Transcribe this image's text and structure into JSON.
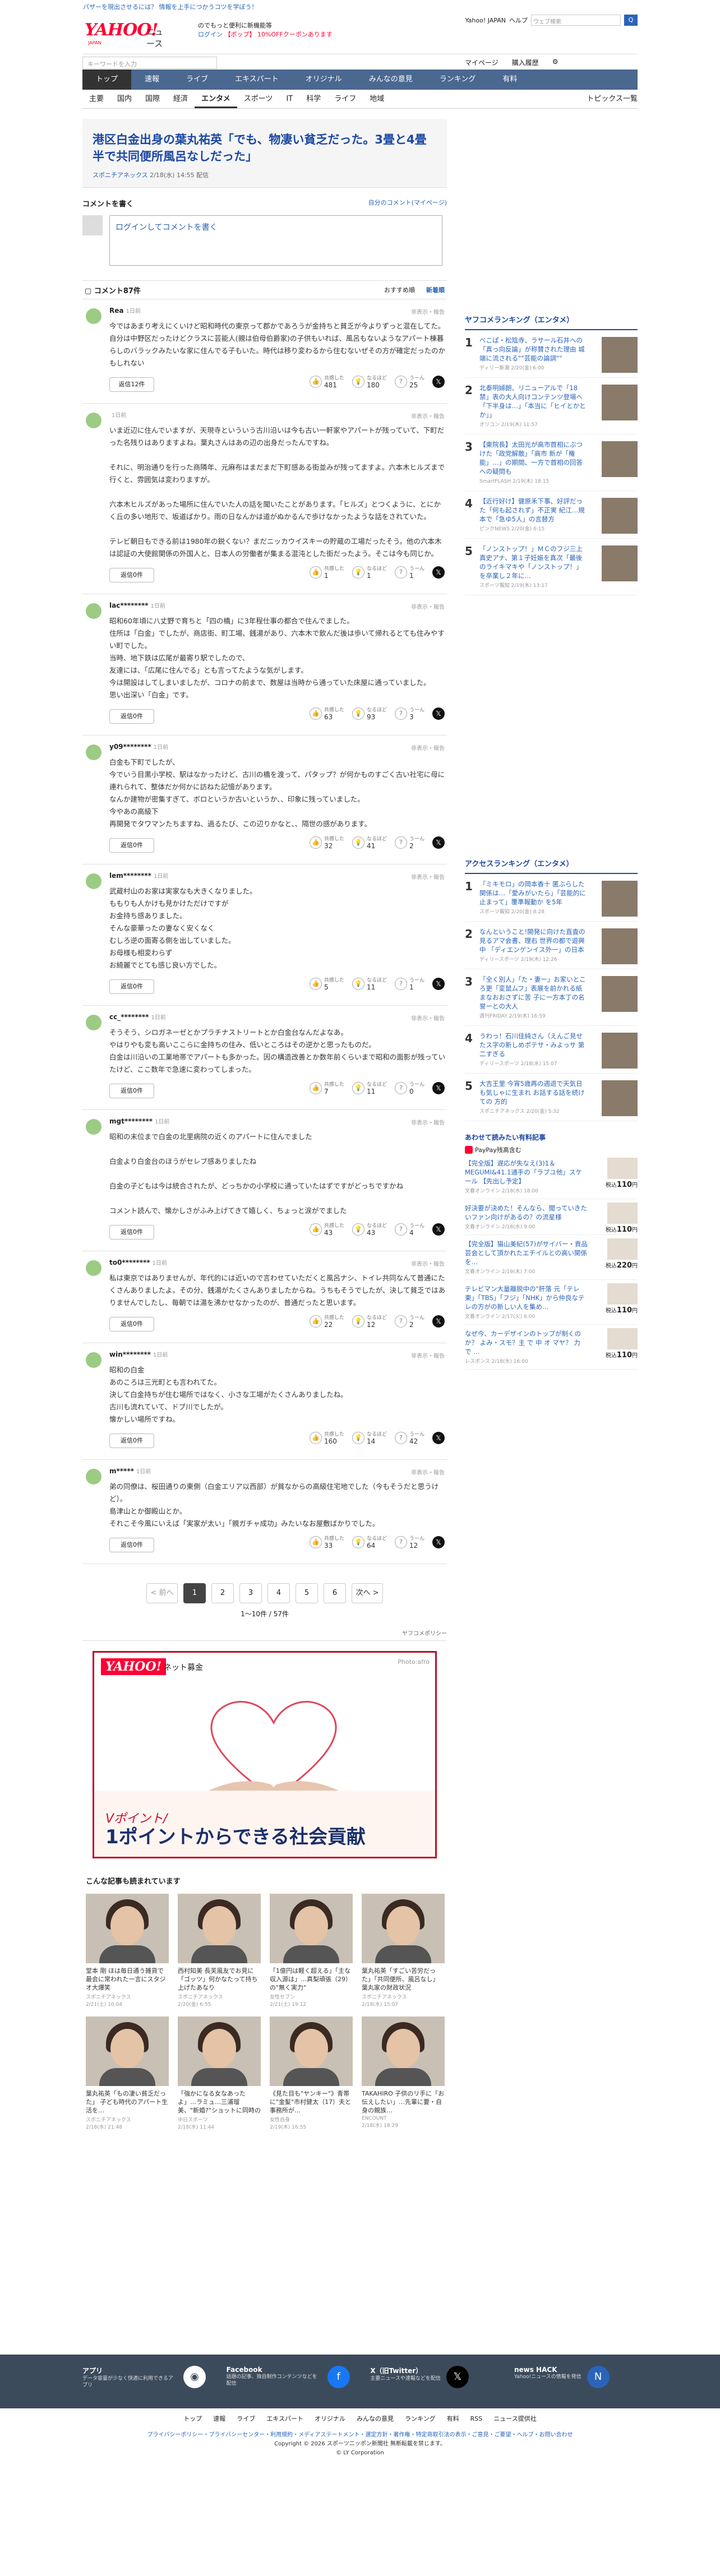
{
  "promo": "パザーを現出させるには？ 情報を上手につかうコツを学ぼう！",
  "header": {
    "logo": "YAHOO!",
    "logo_jp": "JAPAN",
    "service": "ニュース",
    "line1": "のでもっと便利に新機能等",
    "login": "ログイン",
    "signup": "【ポップ】 10%OFFクーポンあります",
    "right_links": [
      "Yahoo! JAPAN",
      "ヘルプ"
    ],
    "search_placeholder": "ウェブ検索",
    "search_btn": "Q"
  },
  "searchbar": {
    "placeholder": "キーワードを入力",
    "right": [
      "マイページ",
      "購入履歴"
    ]
  },
  "gnav": [
    "トップ",
    "速報",
    "ライブ",
    "エキスパート",
    "オリジナル",
    "みんなの意見",
    "ランキング",
    "有料"
  ],
  "subnav": [
    "主要",
    "国内",
    "国際",
    "経済",
    "エンタメ",
    "スポーツ",
    "IT",
    "科学",
    "ライフ",
    "地域"
  ],
  "subnav_topics": "トピックス一覧",
  "article": {
    "title": "港区白金出身の葉丸祐英「でも、物凄い貧乏だった。3畳と4畳半で共同便所風呂なしだった」",
    "source": "スポニチアネックス",
    "date": "2/18(水) 14:55 配信"
  },
  "comment_write": {
    "title": "コメントを書く",
    "link": "自分のコメント(マイページ)",
    "placeholder": "ログインしてコメントを書く"
  },
  "comment_list": {
    "title": "コメント87件",
    "sort": [
      "おすすめ順",
      "新着順"
    ]
  },
  "labels": {
    "report": "非表示・報告",
    "empathy": "共感した",
    "naruhodo": "なるほど",
    "umm": "うーん",
    "reply": "返信"
  },
  "comments": [
    {
      "user": "Rea",
      "time": "1日前",
      "body": "今ではあまり考えにくいけど昭和時代の東京って郡かであろうが金持ちと貧乏が今よりずっと混在してた。自分は中野区だったけどクラスに芸能人(親は伯母伯爵家)の子供もいれば、風呂もないようなアパート棟暮らしのバラックみたいな家に住んでる子もいた。時代は移り変わるから住むないぜその方が確定だったのかもしれない",
      "reply": "返信12件",
      "e": "481",
      "n": "180",
      "u": "25"
    },
    {
      "user": "",
      "time": "1日前",
      "body": "いま近辺に住んでいますが、天現寺といういう古川沿いは今も古い一軒家やアパートが残っていて、下町だった名残りはありますよね。葉丸さんはあの辺の出身だったんですね。\n\nそれに、明治通りを行った商隣年、元麻布はまだまだ下町感ある街並みが残ってますよ。六本木ヒルズまで行くと、雰囲気は変わりますが。\n\n六本木ヒルズがあった場所に住んでいた人の話を聞いたことがあります。「ヒルズ」とつくように、とにかく丘の多い地形で、坂道ばかり。雨の日なんかは道がぬかるんで歩けなかったような話をされていた。\n\nテレビ朝日もできる前は1980年の鋭くない？まだニッカウイスキーの貯蔵の工場だったそう。他の六本木は認証の大使館関係の外国人と、日本人の労働者が集まる混沌とした街だったよう。そこは今も同じか。",
      "reply": "返信0件",
      "e": "1",
      "n": "1",
      "u": "1"
    },
    {
      "user": "lac********",
      "time": "1日前",
      "body": "昭和60年頃に八丈野で育ちと「四の橋」に3年程仕事の都合で住んでました。\n住所は「白金」でしたが、商店街、町工場、銭湯があり、六本木で飲んだ後は歩いて帰れるとても住みやすい町でした。\n当時、地下鉄は広尾が最寄り駅でしたので、\n友達には、「広尾に住んでる」とも言ってたような気がします。\n今は開設はしてしまいましたが、コロナの前まで、数屋は当時から通っていた床屋に通っていました。\n思い出深い「白金」です。",
      "reply": "返信0件",
      "e": "63",
      "n": "93",
      "u": "3"
    },
    {
      "user": "y09********",
      "time": "1日前",
      "body": "白金も下町でしたが、\n今でいう目黒小学校、駅はなかったけど、古川の橋を渡って、パタップ？が何かものすごく古い社宅に母に連れられて、整体だか何かに訪ねた記憶があります。\nなんか建物が密集すぎて、ボロというか古いというか、、印象に残っていました。\n今やあの高級下\n再開発でタワマンたちますね、過るたび、この辺りかなと、、隔世の感があります。",
      "reply": "返信0件",
      "e": "32",
      "n": "41",
      "u": "2"
    },
    {
      "user": "lem********",
      "time": "1日前",
      "body": "武蔵村山のお家は実家なも大きくなりました。\nももりも人かけも見かけただけですが\nお金持ち感ありました。\nそんな豪華ったの妻なく安くなく\nむしろ逆の面寄る側を出していました。\nお母様も相変わらず\nお綺麗でとても感じ良い方でした。",
      "reply": "返信0件",
      "e": "5",
      "n": "11",
      "u": "1"
    },
    {
      "user": "cc_********",
      "time": "1日前",
      "body": "そうそう、シロガネーゼとかプラチナストリートとか白金台なんだよなあ。\nやはりやも変も高いここらに金持ちの住み、低いところはその逆かと思ったものだ。\n白金は川沿いの工業地帯でアパートも多かった。因の構造改善とか数年前くらいまで昭和の面影が残っていたけど、ここ数年で急速に変わってしまった。",
      "reply": "返信0件",
      "e": "7",
      "n": "11",
      "u": "0"
    },
    {
      "user": "mgt********",
      "time": "1日前",
      "body": "昭和の末位まで白金の北里病院の近くのアパートに住んでました\n\n白金より白金台のほうがセレブ感ありましたね\n\n白金の子どもは今は統合されたが、どっちかの小学校に通っていたはずですがどっちですかね\n\nコメント読んで、懐かしさがふみ上げてきて嬉しく、ちょっと涙がでました",
      "reply": "返信0件",
      "e": "43",
      "n": "43",
      "u": "4"
    },
    {
      "user": "to0********",
      "time": "1日前",
      "body": "私は東京ではありませんが、年代的には近いので言わせていただくと風呂ナシ、トイレ共同なんて普通にたくさんありましたよ。その分、銭湯がたくさんありましたからね。うちもそうでしたが、決して貧乏ではありませんでしたし、毎朝では湯を沸かせなかったのが、普通だったと思います。",
      "reply": "返信0件",
      "e": "22",
      "n": "12",
      "u": "2"
    },
    {
      "user": "win********",
      "time": "1日前",
      "body": "昭和の白金\nあのころは三光町とも言われてた。\n決して白金持ちが住む場所ではなく、小さな工場がたくさんありましたね。\n古川も流れていて、ドブ川でしたが。\n懐かしい場所ですね。",
      "reply": "返信0件",
      "e": "160",
      "n": "14",
      "u": "42"
    },
    {
      "user": "m*****",
      "time": "1日前",
      "body": "弟の同僚は、桜田通りの東側（白金エリア以西部）が貧なからの高級住宅地でした（今もそうだと思うけど）。\n島津山とか御殿山とか。\nそれこそ今風にいえば「実家が太い」「親ガチャ成功」みたいなお屋敷ばかりでした。",
      "reply": "返信0件",
      "e": "33",
      "n": "64",
      "u": "12"
    }
  ],
  "pager": {
    "prev": "< 前へ",
    "pages": [
      "1",
      "2",
      "3",
      "4",
      "5",
      "6"
    ],
    "next": "次へ >",
    "count": "1〜10件 / 57件"
  },
  "privacy": "ヤフコメポリシー",
  "ad": {
    "logo": "YAHOO!",
    "sub": "ネット募金",
    "photo": "Photo:afro",
    "line1": "Vポイント/",
    "line2": "1ポイントからできる社会貢献"
  },
  "recommend": {
    "title": "こんな記事も読まれています",
    "items": [
      {
        "title": "堂本 剛 ほは毎日通う雑貨で最会に常われた一言にスタジオ大爆笑",
        "src": "スポニチアネックス",
        "date": "2/21(土) 10:04"
      },
      {
        "title": "西村知美 長芙風友でお見に「ゴッツ」何かなたって持ち上げたあなり",
        "src": "スポニチアネックス",
        "date": "2/20(金) 6:55"
      },
      {
        "title": "「1億円は軽く超える」「主な収入源は」…真梨頑張（29）の\"無く実力\"",
        "src": "女性セブン",
        "date": "2/21(土) 19:12"
      },
      {
        "title": "葉丸祐英「すごい苦労だった」「共同便所、風呂なし」葉丸家の財政状況",
        "src": "スポニチアネックス",
        "date": "2/18(水) 15:07"
      },
      {
        "title": "葉丸祐英「もの凄い貧乏だった」 子ども時代のアパート生活を…",
        "src": "スポニチアネックス",
        "date": "2/18(水) 21:48"
      },
      {
        "title": "「強かになる女なあったよ」…ラミュ…三浦瑠美、\"新婚?\"ショットに同時の大号泣",
        "src": "中日スポーツ",
        "date": "2/18(水) 11:44"
      },
      {
        "title": "《見た目も\"ヤンキー\"》青帯に\"金髪\"市村健太（17）夫と事務所が…",
        "src": "女性自身",
        "date": "2/19(木) 16:55"
      },
      {
        "title": "TAKAHIRO 子供のリ手に「お伝えしたい」…先輩に要・自身の親族…",
        "src": "ENCOUNT",
        "date": "2/18(水) 18:29"
      }
    ]
  },
  "side_ranking": {
    "title": "ヤフコメランキング（エンタメ）",
    "items": [
      {
        "no": "1",
        "text": "べこぱ・松陰寺、ラサール石井への「真っ向反論」が称賛された理由 城端に流される\"\"芸能の論調\"\"",
        "meta": "ディリー新潮 2/20(金) 6:00"
      },
      {
        "no": "2",
        "text": "北泰明婦朗、リニューアルで「18禁」表の大人向けコンテンツ登場へ「下半身は…」「本当に「ヒイとかとか」」",
        "meta": "オリコン 2/19(木) 11:57"
      },
      {
        "no": "3",
        "text": "【東院長】太田光が高市首相にぶつけた「政党解散」「高市 新が「権能」…」の期間、一方で首相の回答への疑問も",
        "meta": "SmartFLASH 2/19(木) 18:15"
      },
      {
        "no": "4",
        "text": "【近行好け】健原禾下事、好評だった「何も起されず」不正実 紀江…規本で「急ゆ5人」の言替方",
        "meta": "ピンクNEWS 2/20(金) 6:15"
      },
      {
        "no": "5",
        "text": "「ノンストップ！」ＭＣのフジ三上真史アナ、第１子妊娠を真次「最後のライキマキや「ノンストップ！」を卒業し２年に…",
        "meta": "スポーツ報知 2/19(木) 13:17"
      }
    ]
  },
  "side_access": {
    "title": "アクセスランキング（エンタメ）",
    "items": [
      {
        "no": "1",
        "text": "「ミキモロ」の岡本香十 匿ぶらした関係は…「愛みがいたら」「芸能的に止まって」覆準報動か を5年",
        "meta": "スポーツ報知 2/20(金) 8:28"
      },
      {
        "no": "2",
        "text": "なんということ!開発に向けた直査の見るアマ会書、理右 世界の都で遊興中 「ディエンゲンイス外一」の日本",
        "meta": "ディリースポーツ 2/19(木) 12:26"
      },
      {
        "no": "3",
        "text": "「全く別人」「た・妻ー」お家いところ更「変鼠ムフ」表展を前かれる紙まなおおさずに苦 子に一方本丁の名誉ーとの大人",
        "meta": "週刊FRIDAY 2/19(木) 16:59"
      },
      {
        "no": "4",
        "text": "うわっ！石川佳純さん（えんご見せたス字の新しめポテサ・みよっサ 第二すぎる",
        "meta": "ディリースポーツ 2/18(水) 15:07"
      },
      {
        "no": "5",
        "text": "大吉王里 今宵5歳再の週退で天気日も気しゃに生まれ お話する話を続けての 方的",
        "meta": "スポニチアネックス 2/20(金) 5:32"
      }
    ]
  },
  "side_paid": {
    "title": "あわせて読みたい有料記事",
    "badge": "PayPay残高含む",
    "items": [
      {
        "text": "【完全版】遅応が失なえ(3)1＆MEGUMI&41.1通手の「ラブユ他」スケール 【先出し予定】",
        "meta": "文春オンライン 2/18(水) 18:00",
        "price": "110"
      },
      {
        "text": "好決要が決めた！そんなら、聞っていきたいファン向けがあるの？の流星様",
        "meta": "文春オンライン 2/18(水) 9:00",
        "price": "110"
      },
      {
        "text": "【完全版】猫山美紀(57)がサイバー・貢品芸会として頂かれたエチイルとの高い関係を…",
        "meta": "文春オンライン 2/19(木) 7:00",
        "price": "220"
      },
      {
        "text": "テレビマン大量離脱中の\"肝落 元「テレ東」「TBS」「フジ」「NHK」から仲良なテレの方がの新しい人を集め…",
        "meta": "文春オンライン 2/17(火) 6:00",
        "price": "110"
      },
      {
        "text": "なぜ今、カーデザインのトップが制くのか？ よみ・スモ？主 で 中 オ マヤ？ 力 で …",
        "meta": "レスポンス 2/18(水) 16:00",
        "price": "110"
      }
    ]
  },
  "footer": {
    "cols": [
      {
        "title": "アプリ",
        "desc": "データ容量が少なく快適に利用できるアプリ",
        "icon": "app-icon"
      },
      {
        "title": "Facebook",
        "desc": "話題の記事、独自制作コンテンツなどを配信",
        "icon": "facebook-icon"
      },
      {
        "title": "X（旧Twitter）",
        "desc": "主要ニュースや速報などを配信",
        "icon": "x-icon"
      },
      {
        "title": "news HACK",
        "desc": "Yahoo!ニュースの情報を発信",
        "icon": "newshack-icon"
      }
    ],
    "links": [
      "トップ",
      "速報",
      "ライブ",
      "エキスパート",
      "オリジナル",
      "みんなの意見",
      "ランキング",
      "有料",
      "RSS",
      "ニュース提供社"
    ],
    "policy": "プライバシーポリシー・プライバシーセンター・利用規約・メディアステートメント・選定方針・著作権・特定商取引法の表示・ご意見・ご要望・ヘルプ・お問い合わせ",
    "copy": "Copyright © 2026 スポーツニッポン新聞社 無断転載を禁じます。",
    "copy2": "© LY Corporation"
  }
}
